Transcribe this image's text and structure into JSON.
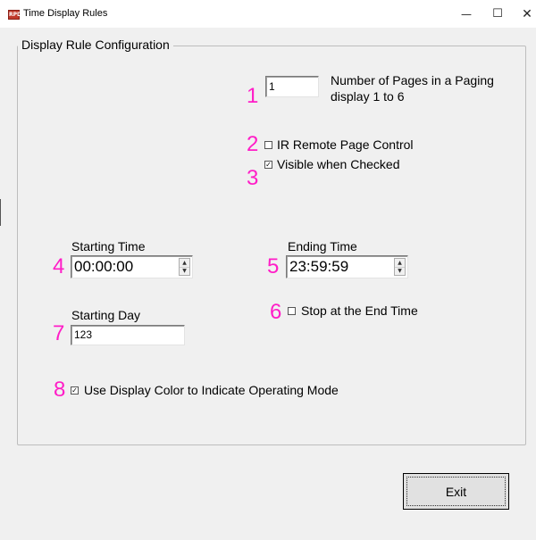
{
  "window": {
    "title": "Time Display Rules",
    "app_icon_text": "RPD",
    "minimize_glyph": "—",
    "maximize_glyph": "☐",
    "close_glyph": "✕"
  },
  "group": {
    "legend": "Display Rule Configuration"
  },
  "markers": [
    "1",
    "2",
    "3",
    "4",
    "5",
    "6",
    "7",
    "8"
  ],
  "marker_color": "#ff1dc7",
  "pages": {
    "value": "1",
    "label_line1": "Number of Pages in a Paging",
    "label_line2": "display 1 to 6"
  },
  "ir_remote": {
    "label": "IR Remote Page Control",
    "checked": false
  },
  "visible": {
    "label": "Visible when Checked",
    "checked": true
  },
  "starting_time": {
    "label": "Starting Time",
    "value": "00:00:00"
  },
  "ending_time": {
    "label": "Ending Time",
    "value": "23:59:59"
  },
  "stop_end": {
    "label": "Stop at the End Time",
    "checked": false
  },
  "starting_day": {
    "label": "Starting Day",
    "value": "123"
  },
  "display_color": {
    "label": "Use Display Color to Indicate Operating Mode",
    "checked": true
  },
  "spin_glyphs": {
    "up": "▲",
    "down": "▼"
  },
  "check_glyph": "✓",
  "exit_button": {
    "label": "Exit"
  }
}
